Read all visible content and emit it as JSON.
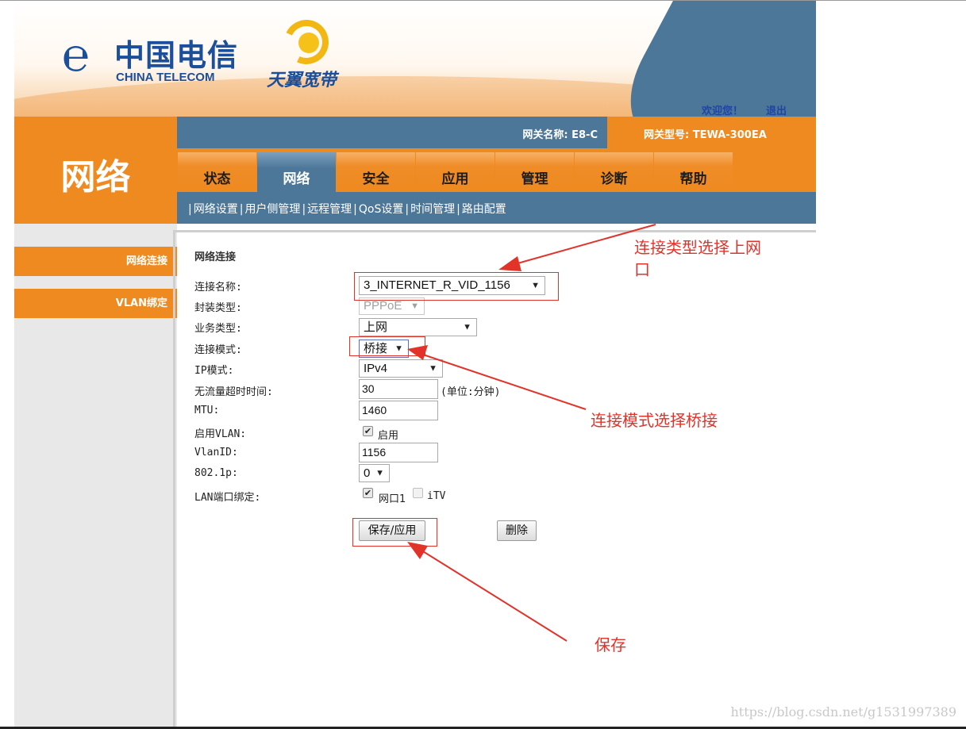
{
  "brand": {
    "telecom_cn": "中国电信",
    "telecom_en": "CHINA TELECOM",
    "broadband": "天翼宽带"
  },
  "header": {
    "welcome": "欢迎您！",
    "logout": "退出",
    "gateway_name": "网关名称:  E8-C",
    "gateway_model": "网关型号:  TEWA-300EA"
  },
  "page_title": "网络",
  "tabs": [
    "状态",
    "网络",
    "安全",
    "应用",
    "管理",
    "诊断",
    "帮助"
  ],
  "subnav": [
    "网络设置",
    "用户侧管理",
    "远程管理",
    "QoS设置",
    "时间管理",
    "路由配置"
  ],
  "sidebar": [
    "网络连接",
    "VLAN绑定"
  ],
  "form": {
    "section_title": "网络连接",
    "labels": {
      "conn_name": "连接名称:",
      "encap": "封装类型:",
      "service": "业务类型:",
      "mode": "连接模式:",
      "ip_mode": "IP模式:",
      "idle_timeout": "无流量超时时间:",
      "mtu": "MTU:",
      "vlan_enable": "启用VLAN:",
      "vlan_id": "VlanID:",
      "p8021p": "802.1p:",
      "lan_bind": "LAN端口绑定:"
    },
    "values": {
      "conn_name": "3_INTERNET_R_VID_1156",
      "encap": "PPPoE",
      "service": "上网",
      "mode": "桥接",
      "ip_mode": "IPv4",
      "idle_timeout": "30",
      "idle_unit": "(单位:分钟)",
      "mtu": "1460",
      "vlan_enable_label": "启用",
      "vlan_id": "1156",
      "p8021p": "0",
      "lan_port1": "网口1",
      "itv": "iTV"
    },
    "save_label": "保存/应用",
    "delete_label": "删除"
  },
  "annotations": {
    "conn_type_line1": "连接类型选择上网",
    "conn_type_line2": "口",
    "mode_note": "连接模式选择桥接",
    "save_note": "保存"
  },
  "watermark": "https://blog.csdn.net/g1531997389",
  "colors": {
    "orange": "#ee8a1f",
    "steel_blue": "#4d7798",
    "annotation_red": "#e2332b",
    "brand_blue": "#1b4f9c"
  }
}
